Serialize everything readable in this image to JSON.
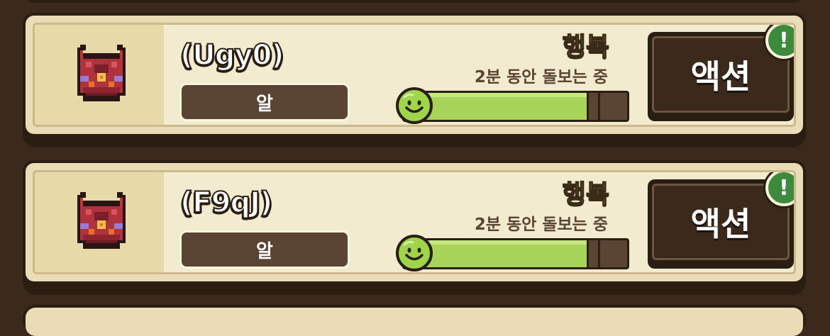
{
  "pets": [
    {
      "name": "(Ugy0)",
      "stage": "알",
      "mood": "행복",
      "care_status": "2분 동안 돌보는 중",
      "happiness_fraction": 0.82,
      "action_label": "액션",
      "alert_symbol": "!",
      "sprite_icon": "red-horned-egg-creature-icon",
      "mood_icon": "smiley-face-icon"
    },
    {
      "name": "(F9qJ)",
      "stage": "알",
      "mood": "행복",
      "care_status": "2분 동안 돌보는 중",
      "happiness_fraction": 0.82,
      "action_label": "액션",
      "alert_symbol": "!",
      "sprite_icon": "red-horned-egg-creature-icon",
      "mood_icon": "smiley-face-icon"
    }
  ],
  "colors": {
    "background": "#3b2a1c",
    "card": "#f3ebcf",
    "mood_text": "#9bd42e",
    "bar_fill": "#a8d45a",
    "alert_badge": "#3e8a3c"
  }
}
